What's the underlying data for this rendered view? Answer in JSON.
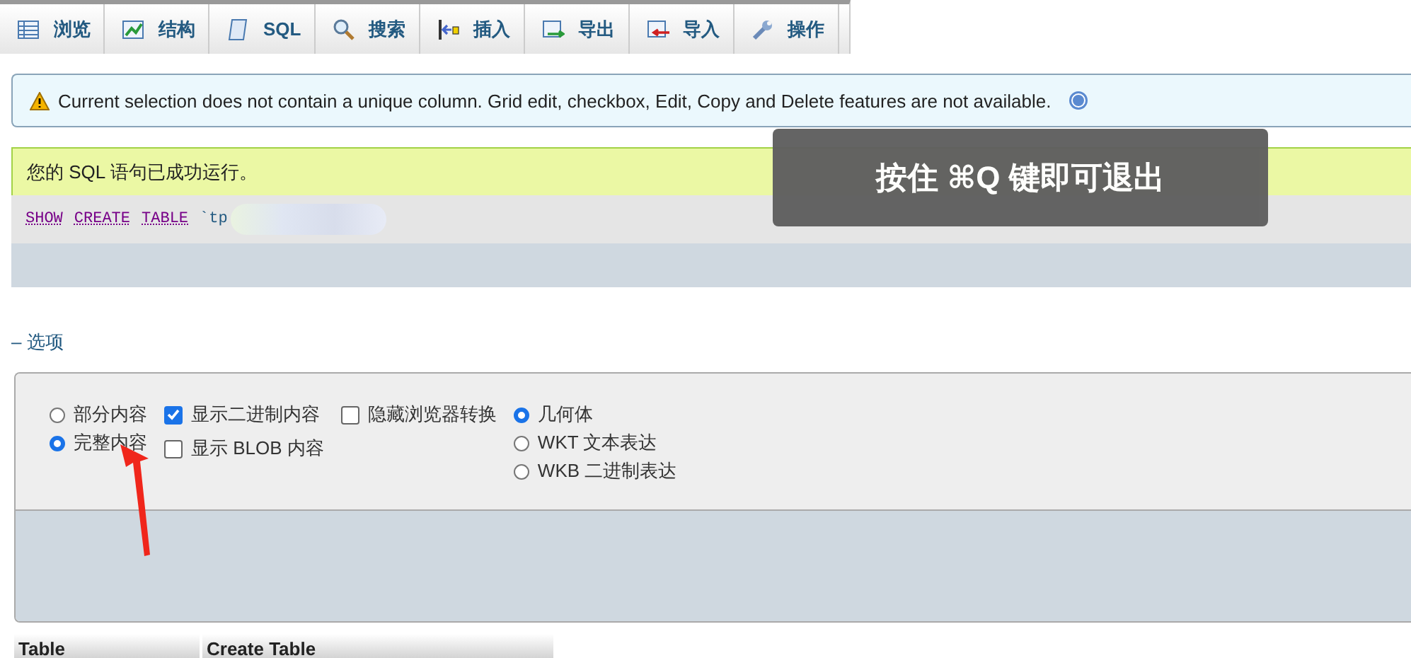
{
  "tabs": [
    {
      "label": "浏览"
    },
    {
      "label": "结构"
    },
    {
      "label": "SQL"
    },
    {
      "label": "搜索"
    },
    {
      "label": "插入"
    },
    {
      "label": "导出"
    },
    {
      "label": "导入"
    },
    {
      "label": "操作"
    }
  ],
  "notice": {
    "text": "Current selection does not contain a unique column. Grid edit, checkbox, Edit, Copy and Delete features are not available."
  },
  "success": {
    "message": "您的 SQL 语句已成功运行。",
    "sql": [
      {
        "text": "SHOW",
        "kind": "keyword"
      },
      {
        "text": "CREATE",
        "kind": "keyword"
      },
      {
        "text": "TABLE",
        "kind": "keyword"
      },
      {
        "text": "`tp",
        "kind": "name"
      }
    ]
  },
  "toast": {
    "text": "按住 ⌘Q 键即可退出"
  },
  "options": {
    "toggle": "– 选项",
    "content_mode": [
      {
        "label": "部分内容",
        "selected": false
      },
      {
        "label": "完整内容",
        "selected": true
      }
    ],
    "checks": [
      {
        "label": "显示二进制内容",
        "checked": true
      },
      {
        "label": "显示 BLOB 内容",
        "checked": false
      }
    ],
    "hide_transform": {
      "label": "隐藏浏览器转换",
      "checked": false
    },
    "geometry": [
      {
        "label": "几何体",
        "selected": true
      },
      {
        "label": "WKT 文本表达",
        "selected": false
      },
      {
        "label": "WKB 二进制表达",
        "selected": false
      }
    ]
  },
  "table": {
    "columns": [
      "Table",
      "Create Table"
    ]
  }
}
